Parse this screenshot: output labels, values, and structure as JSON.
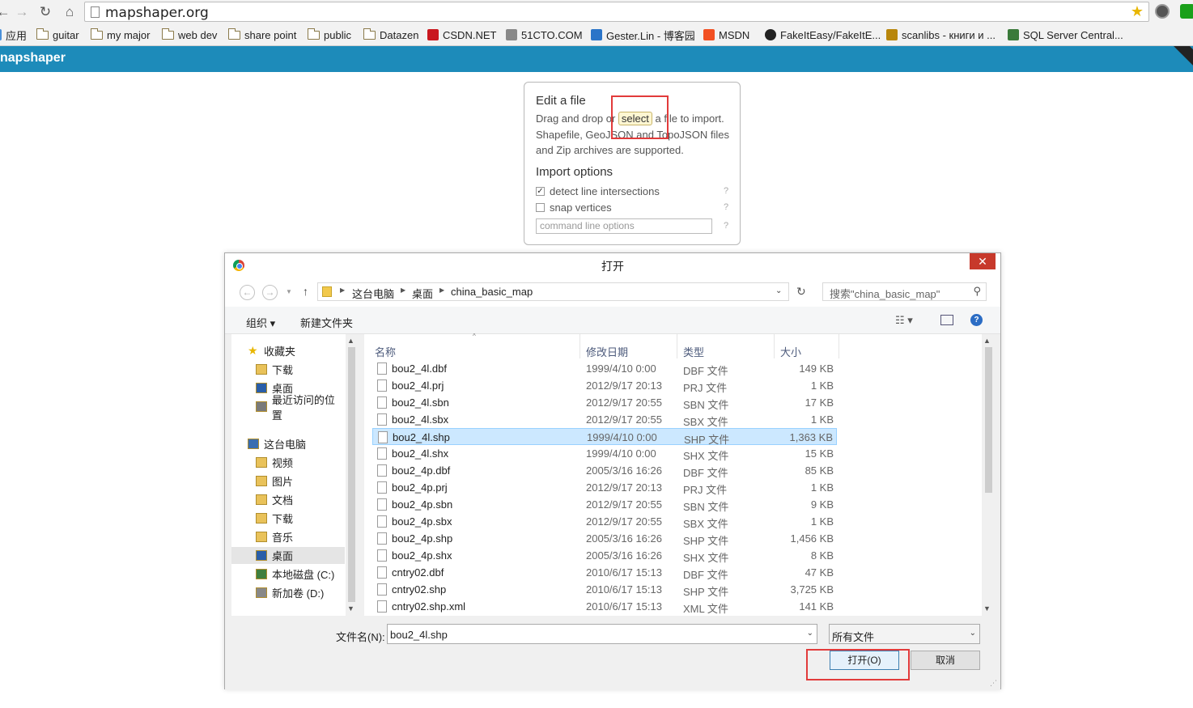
{
  "browser": {
    "url": "mapshaper.org",
    "bookmarks": [
      {
        "label": "应用",
        "icon": "apps-icon"
      },
      {
        "label": "guitar",
        "icon": "folder-icon"
      },
      {
        "label": "my major",
        "icon": "folder-icon"
      },
      {
        "label": "web dev",
        "icon": "folder-icon"
      },
      {
        "label": "share point",
        "icon": "folder-icon"
      },
      {
        "label": "public",
        "icon": "folder-icon"
      },
      {
        "label": "Datazen",
        "icon": "folder-icon"
      },
      {
        "label": "CSDN.NET",
        "icon": "csdn-icon"
      },
      {
        "label": "51CTO.COM",
        "icon": "51cto-icon"
      },
      {
        "label": "Gester.Lin - 博客园",
        "icon": "cnblogs-icon"
      },
      {
        "label": "MSDN",
        "icon": "msdn-icon"
      },
      {
        "label": "FakeItEasy/FakeItE...",
        "icon": "github-icon"
      },
      {
        "label": "scanlibs - книги и ...",
        "icon": "scanlibs-icon"
      },
      {
        "label": "SQL Server Central...",
        "icon": "sqlservercentral-icon"
      }
    ]
  },
  "app": {
    "logo": "napshaper",
    "header_color": "#1d8bba"
  },
  "import_box": {
    "title": "Edit a file",
    "line1_pre": "Drag and drop or",
    "select_label": "select",
    "line1_post": "a file to import.",
    "line2": "Shapefile, GeoJSON and TopoJSON files",
    "line3": "and Zip archives are supported.",
    "options_title": "Import options",
    "opt_detect": "detect line intersections",
    "opt_detect_checked": true,
    "opt_snap": "snap vertices",
    "opt_snap_checked": false,
    "cmd_placeholder": "command line options",
    "help": "?"
  },
  "dialog": {
    "title": "打开",
    "close": "✕",
    "breadcrumb": [
      "这台电脑",
      "桌面",
      "china_basic_map"
    ],
    "search_placeholder": "搜索\"china_basic_map\"",
    "toolbar_organize": "组织 ▾",
    "toolbar_new_folder": "新建文件夹",
    "nav": [
      {
        "label": "收藏夹",
        "icon": "star-icon",
        "indent": 0
      },
      {
        "label": "下载",
        "icon": "download-folder-icon",
        "indent": 1
      },
      {
        "label": "桌面",
        "icon": "desktop-icon",
        "indent": 1
      },
      {
        "label": "最近访问的位置",
        "icon": "recent-places-icon",
        "indent": 1
      },
      {
        "label": "这台电脑",
        "icon": "computer-icon",
        "indent": 0
      },
      {
        "label": "视频",
        "icon": "videos-folder-icon",
        "indent": 1
      },
      {
        "label": "图片",
        "icon": "pictures-folder-icon",
        "indent": 1
      },
      {
        "label": "文档",
        "icon": "documents-folder-icon",
        "indent": 1
      },
      {
        "label": "下载",
        "icon": "download-folder-icon",
        "indent": 1
      },
      {
        "label": "音乐",
        "icon": "music-folder-icon",
        "indent": 1
      },
      {
        "label": "桌面",
        "icon": "desktop-folder-icon",
        "indent": 1,
        "selected": true
      },
      {
        "label": "本地磁盘 (C:)",
        "icon": "local-disk-icon",
        "indent": 1
      },
      {
        "label": "新加卷 (D:)",
        "icon": "drive-icon",
        "indent": 1
      }
    ],
    "columns": {
      "name": "名称",
      "date": "修改日期",
      "type": "类型",
      "size": "大小"
    },
    "files": [
      {
        "name": "bou2_4l.dbf",
        "date": "1999/4/10 0:00",
        "type": "DBF 文件",
        "size": "149 KB"
      },
      {
        "name": "bou2_4l.prj",
        "date": "2012/9/17 20:13",
        "type": "PRJ 文件",
        "size": "1 KB"
      },
      {
        "name": "bou2_4l.sbn",
        "date": "2012/9/17 20:55",
        "type": "SBN 文件",
        "size": "17 KB"
      },
      {
        "name": "bou2_4l.sbx",
        "date": "2012/9/17 20:55",
        "type": "SBX 文件",
        "size": "1 KB"
      },
      {
        "name": "bou2_4l.shp",
        "date": "1999/4/10 0:00",
        "type": "SHP 文件",
        "size": "1,363 KB",
        "selected": true
      },
      {
        "name": "bou2_4l.shx",
        "date": "1999/4/10 0:00",
        "type": "SHX 文件",
        "size": "15 KB"
      },
      {
        "name": "bou2_4p.dbf",
        "date": "2005/3/16 16:26",
        "type": "DBF 文件",
        "size": "85 KB"
      },
      {
        "name": "bou2_4p.prj",
        "date": "2012/9/17 20:13",
        "type": "PRJ 文件",
        "size": "1 KB"
      },
      {
        "name": "bou2_4p.sbn",
        "date": "2012/9/17 20:55",
        "type": "SBN 文件",
        "size": "9 KB"
      },
      {
        "name": "bou2_4p.sbx",
        "date": "2012/9/17 20:55",
        "type": "SBX 文件",
        "size": "1 KB"
      },
      {
        "name": "bou2_4p.shp",
        "date": "2005/3/16 16:26",
        "type": "SHP 文件",
        "size": "1,456 KB"
      },
      {
        "name": "bou2_4p.shx",
        "date": "2005/3/16 16:26",
        "type": "SHX 文件",
        "size": "8 KB"
      },
      {
        "name": "cntry02.dbf",
        "date": "2010/6/17 15:13",
        "type": "DBF 文件",
        "size": "47 KB"
      },
      {
        "name": "cntry02.shp",
        "date": "2010/6/17 15:13",
        "type": "SHP 文件",
        "size": "3,725 KB"
      },
      {
        "name": "cntry02.shp.xml",
        "date": "2010/6/17 15:13",
        "type": "XML 文件",
        "size": "141 KB"
      }
    ],
    "filename_label": "文件名(N):",
    "filename_value": "bou2_4l.shp",
    "filetype_value": "所有文件",
    "open_label": "打开(O)",
    "cancel_label": "取消"
  }
}
